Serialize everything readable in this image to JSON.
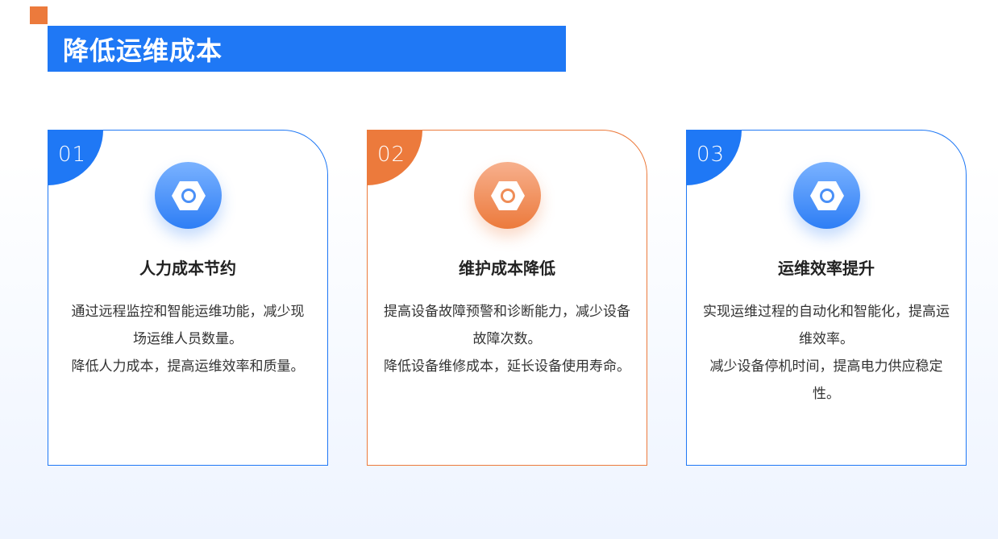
{
  "page": {
    "title": "降低运维成本"
  },
  "colors": {
    "primary_blue": "#1f78f5",
    "accent_orange": "#ec7a3c"
  },
  "cards": [
    {
      "number": "01",
      "icon": "hex-nut-icon",
      "title": "人力成本节约",
      "lines": [
        "通过远程监控和智能运维功能，减少现场运维人员数量。",
        "降低人力成本，提高运维效率和质量。"
      ]
    },
    {
      "number": "02",
      "icon": "hex-nut-icon",
      "title": "维护成本降低",
      "lines": [
        "提高设备故障预警和诊断能力，减少设备故障次数。",
        "降低设备维修成本，延长设备使用寿命。"
      ]
    },
    {
      "number": "03",
      "icon": "hex-nut-icon",
      "title": "运维效率提升",
      "lines": [
        "实现运维过程的自动化和智能化，提高运维效率。",
        "减少设备停机时间，提高电力供应稳定性。"
      ]
    }
  ]
}
